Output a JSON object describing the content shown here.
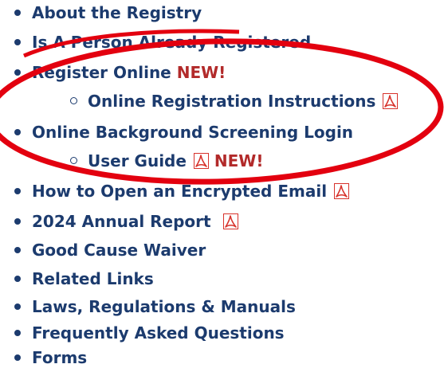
{
  "menu": {
    "items": [
      {
        "label": "About the Registry"
      },
      {
        "label": "Is A Person Already Registered"
      },
      {
        "label": "Register Online",
        "badge": "NEW!"
      },
      {
        "label": "Online Registration Instructions"
      },
      {
        "label": "Online Background Screening Login"
      },
      {
        "label": "User Guide",
        "badge": "NEW!"
      },
      {
        "label": "How to Open an Encrypted Email"
      },
      {
        "label": "2024 Annual Report"
      },
      {
        "label": "Good Cause Waiver"
      },
      {
        "label": "Related Links"
      },
      {
        "label": "Laws, Regulations & Manuals"
      },
      {
        "label": "Frequently Asked Questions"
      },
      {
        "label": "Forms"
      }
    ]
  },
  "colors": {
    "link": "#1c3b6e",
    "new_badge": "#b22a2a",
    "highlight_oval": "#e3000f",
    "pdf_icon": "#d7322b"
  },
  "icons": {
    "pdf": "pdf-document-icon"
  }
}
